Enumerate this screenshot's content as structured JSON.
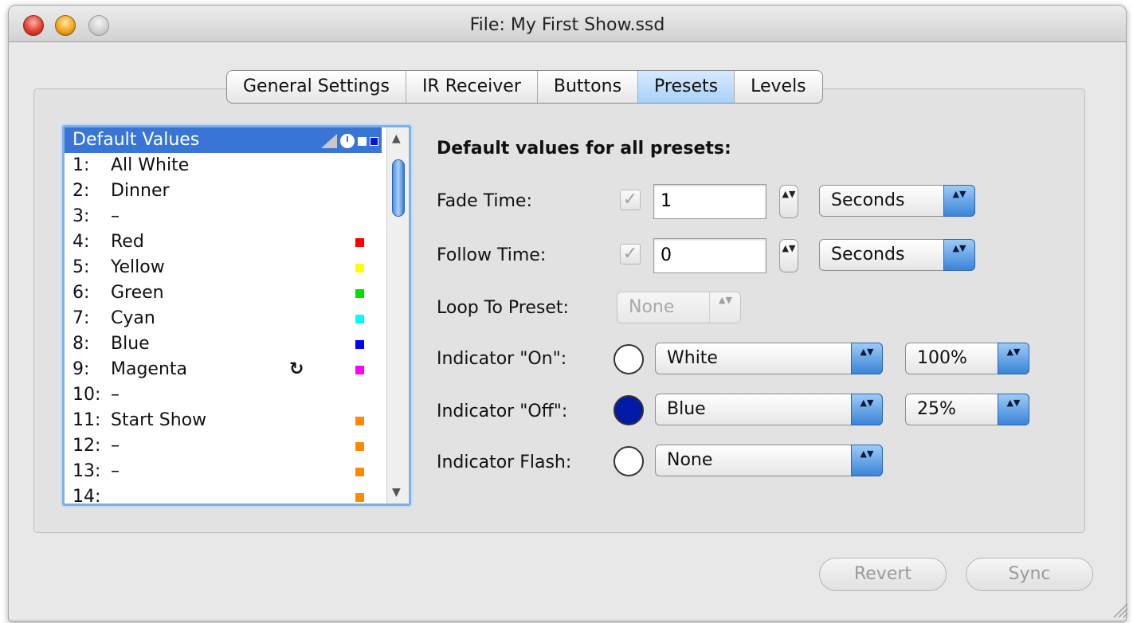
{
  "window": {
    "title": "File: My First Show.ssd"
  },
  "tabs": [
    {
      "label": "General Settings",
      "active": false
    },
    {
      "label": "IR Receiver",
      "active": false
    },
    {
      "label": "Buttons",
      "active": false
    },
    {
      "label": "Presets",
      "active": true
    },
    {
      "label": "Levels",
      "active": false
    }
  ],
  "preset_list": {
    "header": "Default Values",
    "rows": [
      {
        "num": "1:",
        "name": "All White",
        "color": null
      },
      {
        "num": "2:",
        "name": "Dinner",
        "color": null
      },
      {
        "num": "3:",
        "name": "–",
        "color": null
      },
      {
        "num": "4:",
        "name": "Red",
        "color": "#ff0000"
      },
      {
        "num": "5:",
        "name": "Yellow",
        "color": "#ffff00"
      },
      {
        "num": "6:",
        "name": "Green",
        "color": "#00e000"
      },
      {
        "num": "7:",
        "name": "Cyan",
        "color": "#00ffff"
      },
      {
        "num": "8:",
        "name": "Blue",
        "color": "#0000ff"
      },
      {
        "num": "9:",
        "name": "Magenta",
        "color": "#ff00ff",
        "loop_icon": "↻"
      },
      {
        "num": "10:",
        "name": "–",
        "color": null
      },
      {
        "num": "11:",
        "name": "Start Show",
        "color": "#ff8a00"
      },
      {
        "num": "12:",
        "name": "–",
        "color": "#ff8a00"
      },
      {
        "num": "13:",
        "name": "–",
        "color": "#ff8a00"
      },
      {
        "num": "14:",
        "name": "",
        "color": "#ff8a00"
      }
    ]
  },
  "form": {
    "heading": "Default values for all presets:",
    "fade_time": {
      "label": "Fade Time:",
      "checked": true,
      "value": "1",
      "unit": "Seconds"
    },
    "follow_time": {
      "label": "Follow Time:",
      "checked": true,
      "value": "0",
      "unit": "Seconds"
    },
    "loop_to_preset": {
      "label": "Loop To Preset:",
      "value": "None"
    },
    "indicator_on": {
      "label": "Indicator \"On\":",
      "color": "White",
      "level": "100%"
    },
    "indicator_off": {
      "label": "Indicator \"Off\":",
      "color": "Blue",
      "level": "25%"
    },
    "indicator_flash": {
      "label": "Indicator Flash:",
      "color": "None"
    }
  },
  "buttons": {
    "revert": "Revert",
    "sync": "Sync"
  },
  "icons": {
    "check": "✓",
    "stepper": "▲▼",
    "scroll_up": "▲",
    "scroll_down": "▼"
  }
}
